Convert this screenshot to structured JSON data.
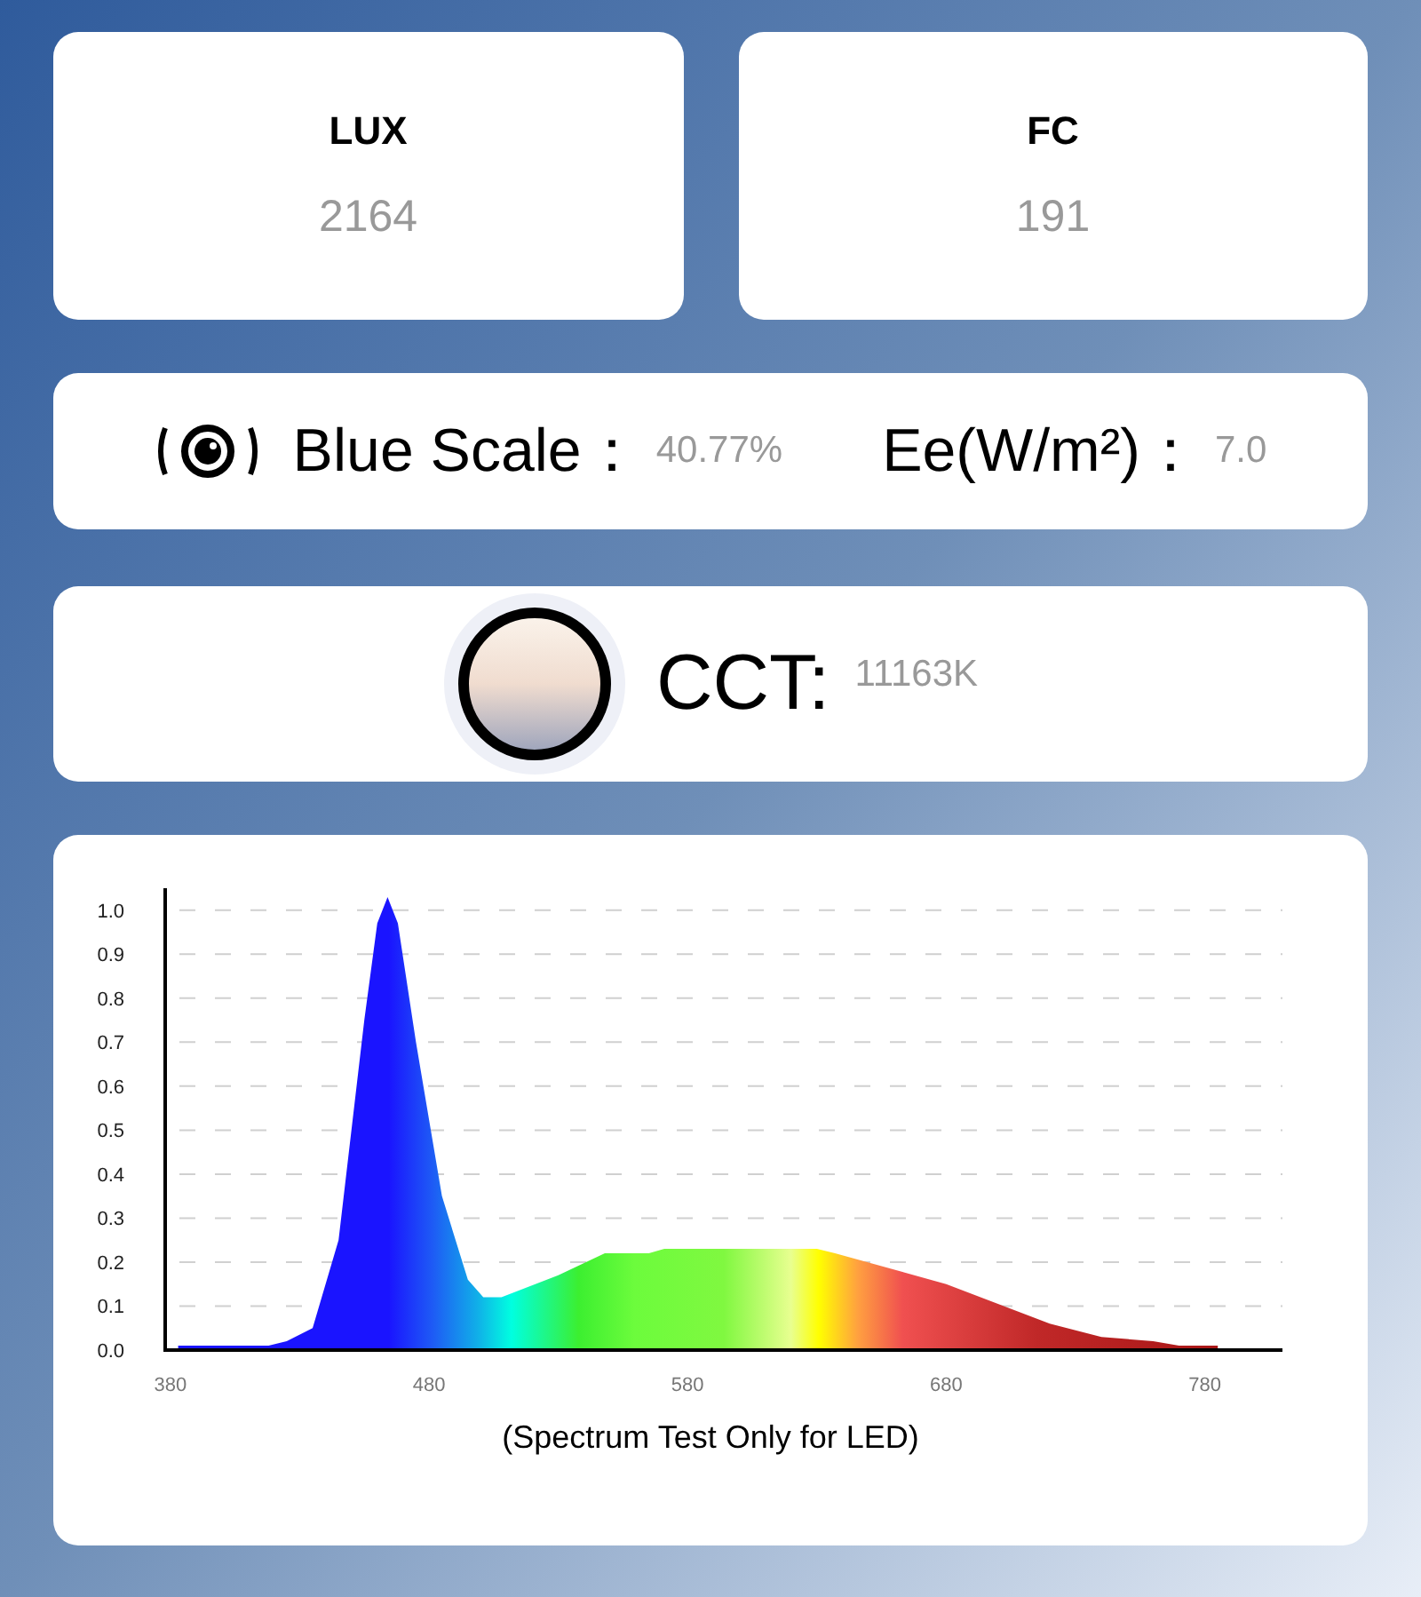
{
  "readings": [
    {
      "label": "LUX",
      "value": "2164"
    },
    {
      "label": "FC",
      "value": "191"
    }
  ],
  "blue_scale": {
    "label": "Blue Scale：",
    "value": "40.77%"
  },
  "irradiance": {
    "label": "Ee(W/m²)：",
    "value": "7.0"
  },
  "cct": {
    "label": "CCT:",
    "value": "11163K"
  },
  "spectrum": {
    "caption": "(Spectrum Test Only for LED)",
    "chart_data": {
      "type": "area",
      "xlim": [
        378,
        810
      ],
      "ylim": [
        0,
        1.05
      ],
      "grid": true,
      "xticks": [
        380,
        480,
        580,
        680,
        780
      ],
      "yticks": [
        {
          "value": 0,
          "label": "0.0"
        },
        0.1,
        0.2,
        0.3,
        0.4,
        0.5,
        0.6,
        0.7,
        0.8,
        0.9,
        {
          "value": 1,
          "label": "1.0"
        }
      ],
      "x": [
        383,
        418,
        425,
        435,
        445,
        455,
        460,
        464,
        468,
        475,
        485,
        495,
        501,
        508,
        530,
        548,
        565,
        571,
        600,
        630,
        637,
        680,
        720,
        740,
        760,
        770,
        785
      ],
      "series": [
        {
          "color": "#1a14ff",
          "values": [
            0.01,
            0.01,
            0.02,
            0.05,
            0.25,
            0.75,
            0.97,
            1.03,
            0.97,
            0.7,
            0.35,
            0.16,
            0.12,
            0.12,
            0.17,
            0.22,
            0.22,
            0.23,
            0.23,
            0.23,
            0.22,
            0.15,
            0.06,
            0.03,
            0.02,
            0.01,
            0.01
          ]
        }
      ]
    }
  }
}
